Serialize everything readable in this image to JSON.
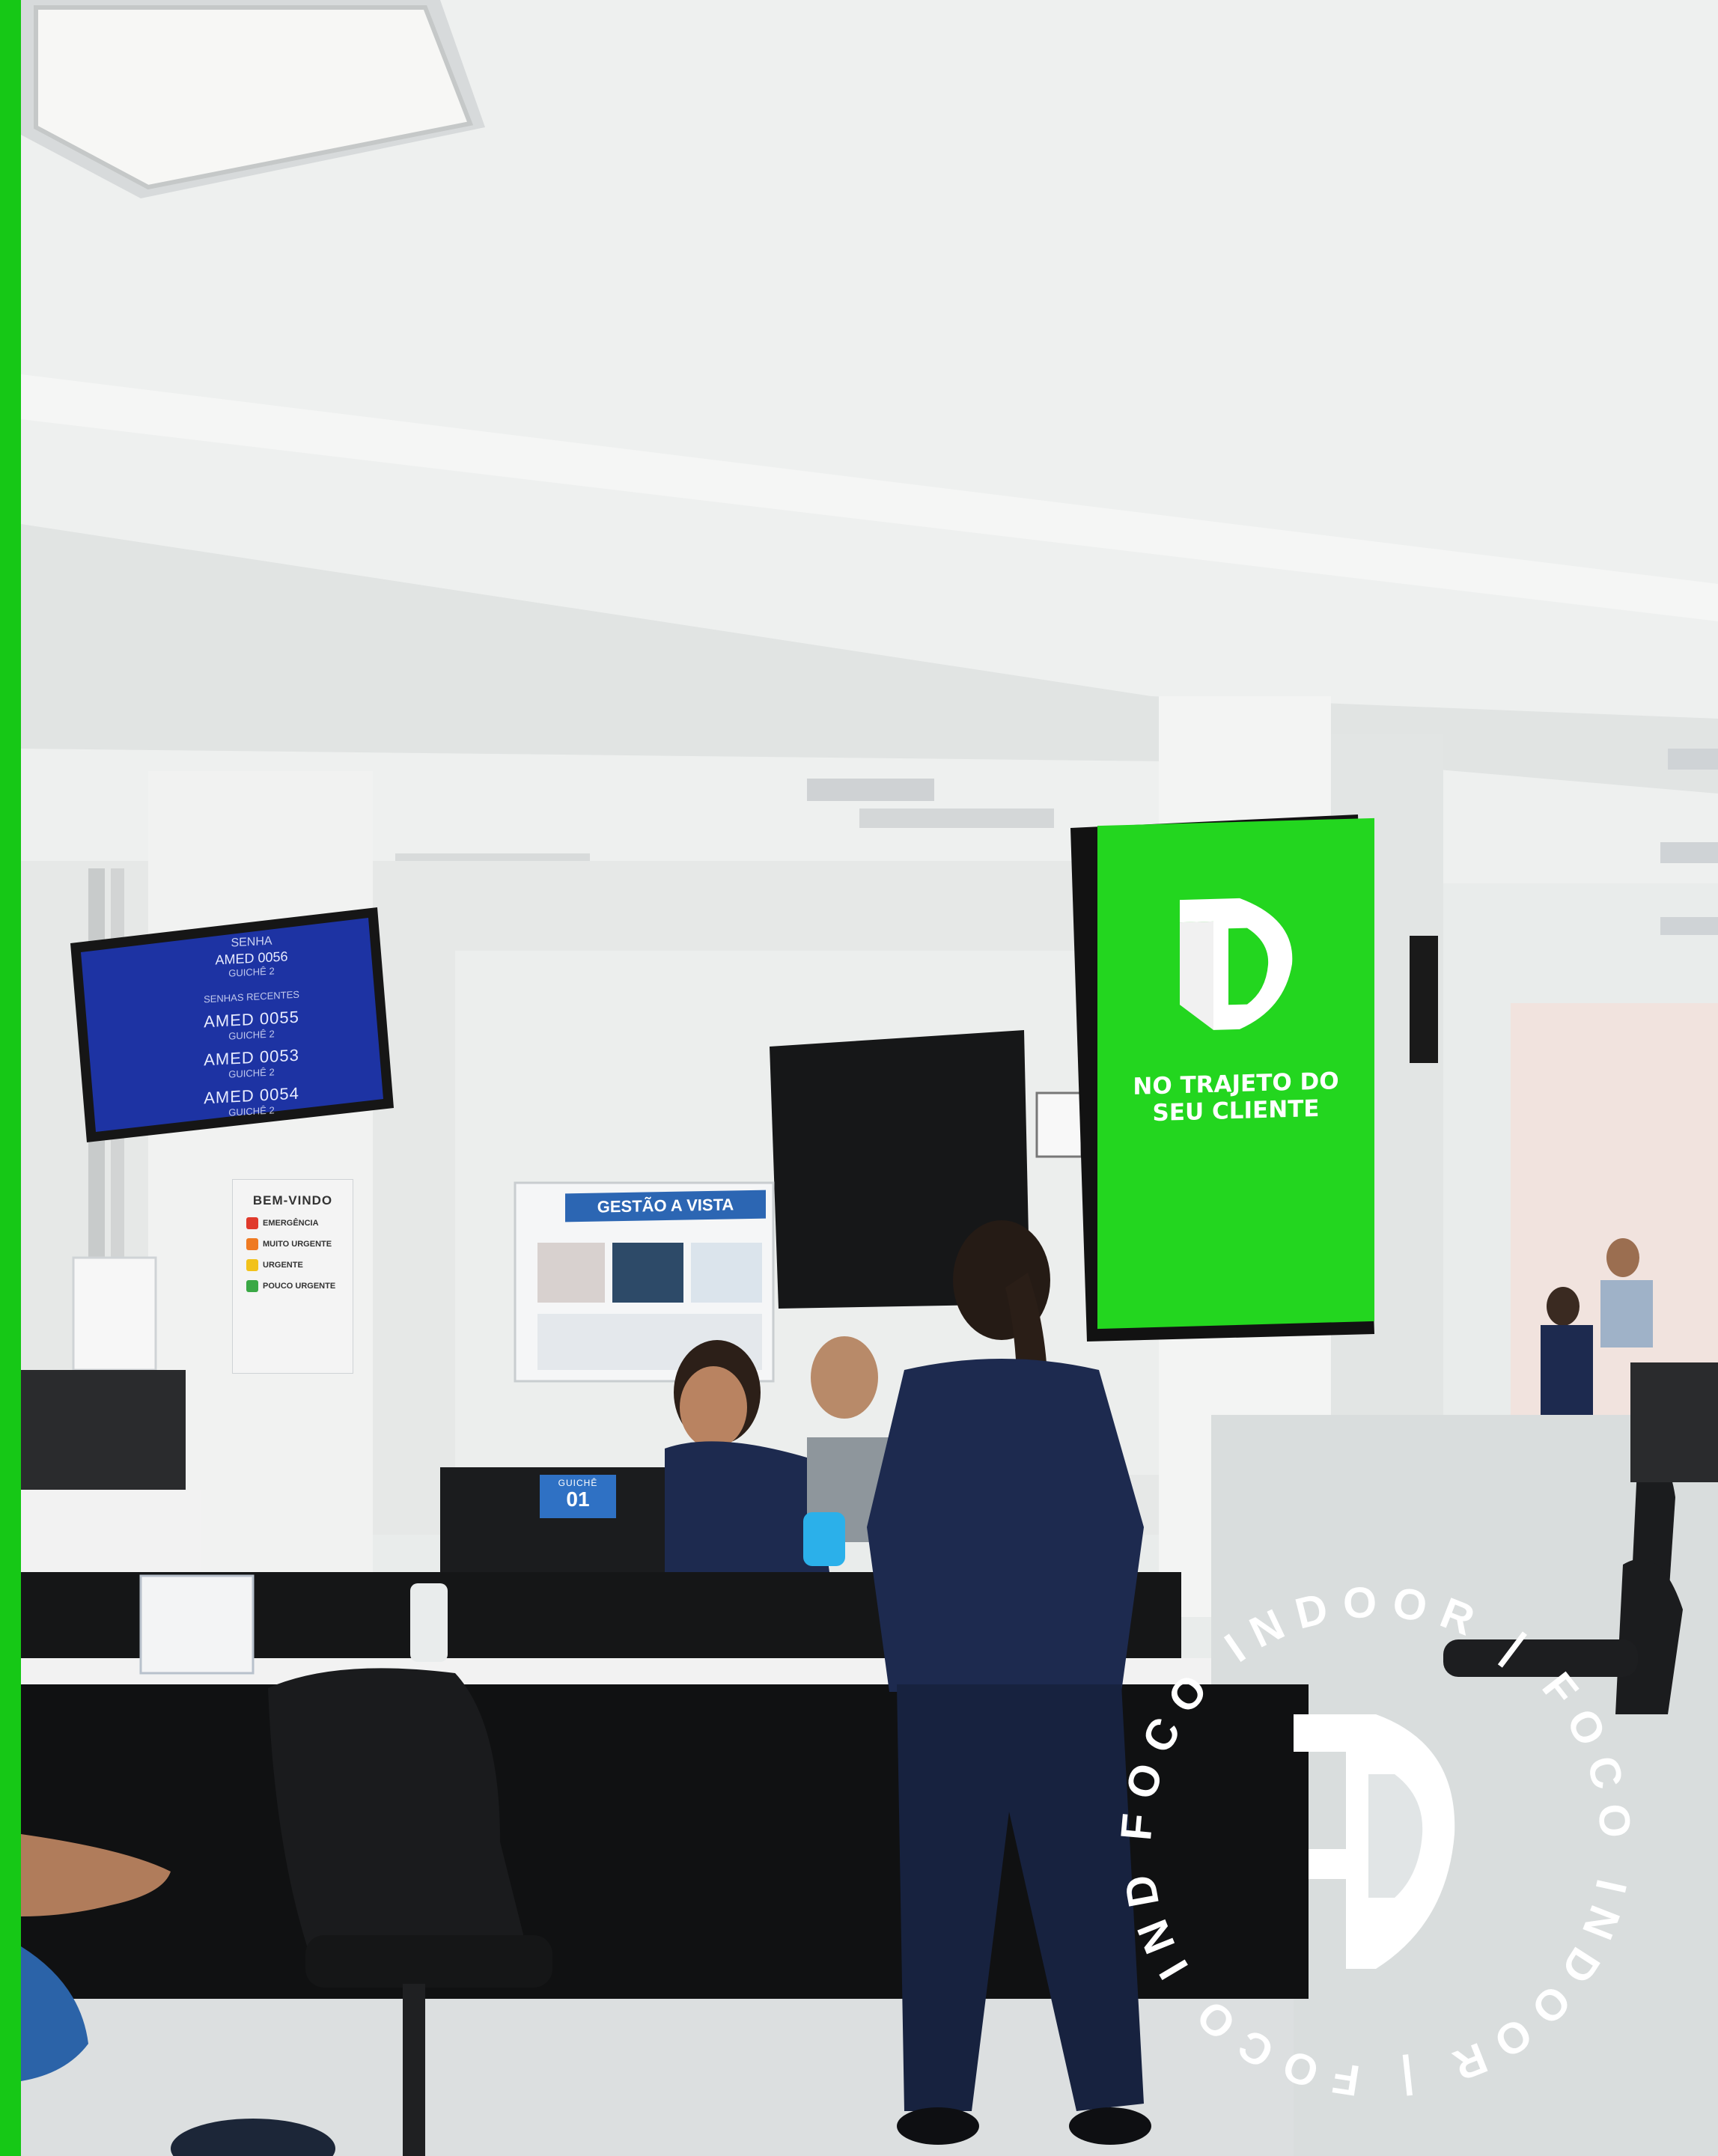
{
  "queue_monitor": {
    "heading": "SENHA",
    "current": "AMED 0056",
    "current_desk": "GUICHÊ 2",
    "recent_heading": "SENHAS RECENTES",
    "recent": [
      {
        "code": "AMED 0055",
        "desk": "GUICHÊ 2"
      },
      {
        "code": "AMED 0053",
        "desk": "GUICHÊ 2"
      },
      {
        "code": "AMED 0054",
        "desk": "GUICHÊ 2"
      }
    ]
  },
  "ad_screen": {
    "logo_icon": "foco-indoor-logo-icon",
    "line1": "NO TRAJETO DO",
    "line2": "SEU CLIENTE",
    "background_color": "#23d61f"
  },
  "poster": {
    "title": "BEM-VINDO",
    "levels": [
      {
        "label": "EMERGÊNCIA",
        "color": "#e03a2c"
      },
      {
        "label": "MUITO URGENTE",
        "color": "#ef7a22"
      },
      {
        "label": "URGENTE",
        "color": "#f2c21b"
      },
      {
        "label": "POUCO URGENTE",
        "color": "#3aa845"
      }
    ]
  },
  "board": {
    "title": "GESTÃO A VISTA"
  },
  "desk_sign": {
    "label": "GUICHÊ",
    "number": "01"
  },
  "watermark": {
    "ring_text": "FOCO INDOOR | FOCO INDOOR | FOCO INDOOR | ",
    "logo_icon": "foco-indoor-logo-icon"
  },
  "colors": {
    "brand_green": "#16c816",
    "scrubs_navy": "#1d2a4f"
  }
}
